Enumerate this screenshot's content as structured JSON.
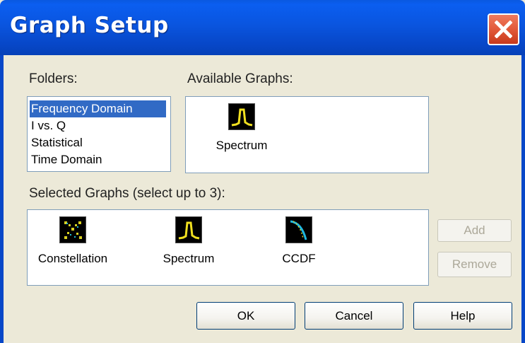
{
  "window": {
    "title": "Graph Setup"
  },
  "folders": {
    "label": "Folders:",
    "items": [
      "Frequency Domain",
      "I vs. Q",
      "Statistical",
      "Time Domain"
    ],
    "selected": "Frequency Domain"
  },
  "available": {
    "label": "Available Graphs:",
    "items": [
      {
        "label": "Spectrum",
        "icon": "spectrum-icon"
      }
    ]
  },
  "selected_graphs": {
    "label": "Selected Graphs (select up to 3):",
    "items": [
      {
        "label": "Constellation",
        "icon": "constellation-icon"
      },
      {
        "label": "Spectrum",
        "icon": "spectrum-icon"
      },
      {
        "label": "CCDF",
        "icon": "ccdf-icon"
      }
    ]
  },
  "buttons": {
    "add": "Add",
    "remove": "Remove",
    "ok": "OK",
    "cancel": "Cancel",
    "help": "Help"
  }
}
